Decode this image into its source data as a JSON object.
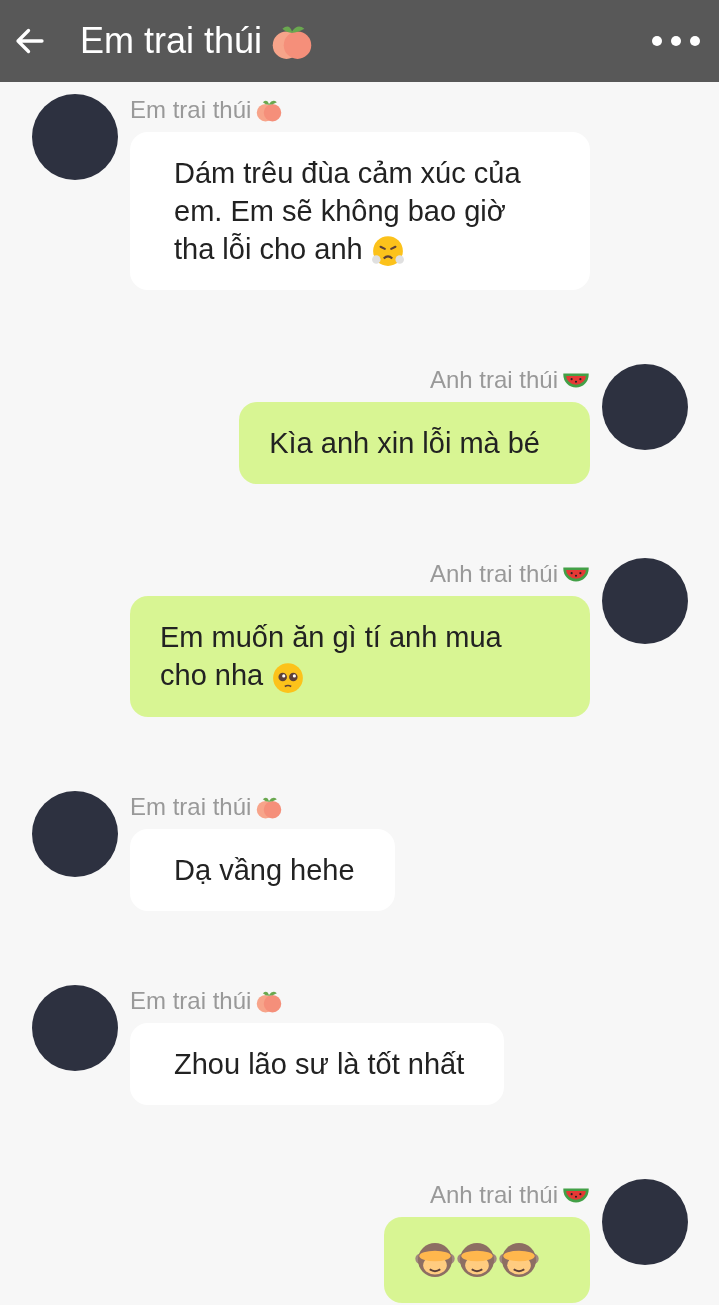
{
  "header": {
    "title": "Em trai thúi",
    "title_icon": {
      "kind": "peach"
    }
  },
  "messages": [
    {
      "kind": "incoming",
      "sender": "Em trai thúi",
      "sender_icon": {
        "kind": "peach"
      },
      "text": "Dám trêu đùa cảm xúc của em. Em sẽ không bao giờ tha lỗi cho anh",
      "emojis": [
        {
          "kind": "steam"
        }
      ]
    },
    {
      "kind": "outgoing",
      "sender": "Anh trai thúi",
      "sender_icon": {
        "kind": "watermelon"
      },
      "text": "Kìa anh xin lỗi mà bé"
    },
    {
      "kind": "outgoing",
      "sender": "Anh trai thúi",
      "sender_icon": {
        "kind": "watermelon"
      },
      "text": "Em muốn ăn gì tí anh mua cho nha",
      "emojis": [
        {
          "kind": "pleading"
        }
      ]
    },
    {
      "kind": "incoming",
      "sender": "Em trai thúi",
      "sender_icon": {
        "kind": "peach"
      },
      "text": "Dạ vầng hehe"
    },
    {
      "kind": "incoming",
      "sender": "Em trai thúi",
      "sender_icon": {
        "kind": "peach"
      },
      "text": "Zhou lão sư là tốt nhất"
    },
    {
      "kind": "outgoing",
      "sender": "Anh trai thúi",
      "sender_icon": {
        "kind": "watermelon"
      },
      "emojis": [
        {
          "kind": "monkey"
        },
        {
          "kind": "monkey"
        },
        {
          "kind": "monkey"
        }
      ]
    }
  ]
}
